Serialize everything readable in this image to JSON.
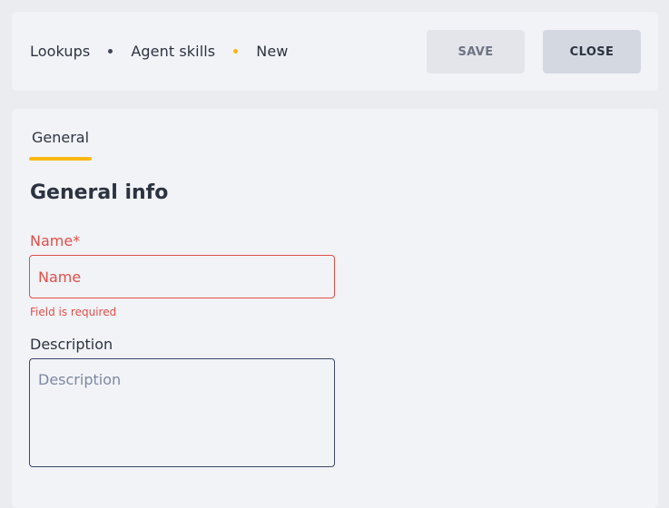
{
  "breadcrumb": {
    "items": [
      "Lookups",
      "Agent skills",
      "New"
    ]
  },
  "toolbar": {
    "save_label": "SAVE",
    "close_label": "CLOSE"
  },
  "tabs": [
    {
      "label": "General",
      "active": true
    }
  ],
  "section": {
    "title": "General info"
  },
  "form": {
    "name": {
      "label": "Name*",
      "placeholder": "Name",
      "value": "",
      "error": "Field is required"
    },
    "description": {
      "label": "Description",
      "placeholder": "Description",
      "value": ""
    }
  },
  "colors": {
    "accent": "#fcb712",
    "error": "#e04f48",
    "text": "#2c3340",
    "background": "#ebecf0",
    "card": "#f2f3f7"
  }
}
